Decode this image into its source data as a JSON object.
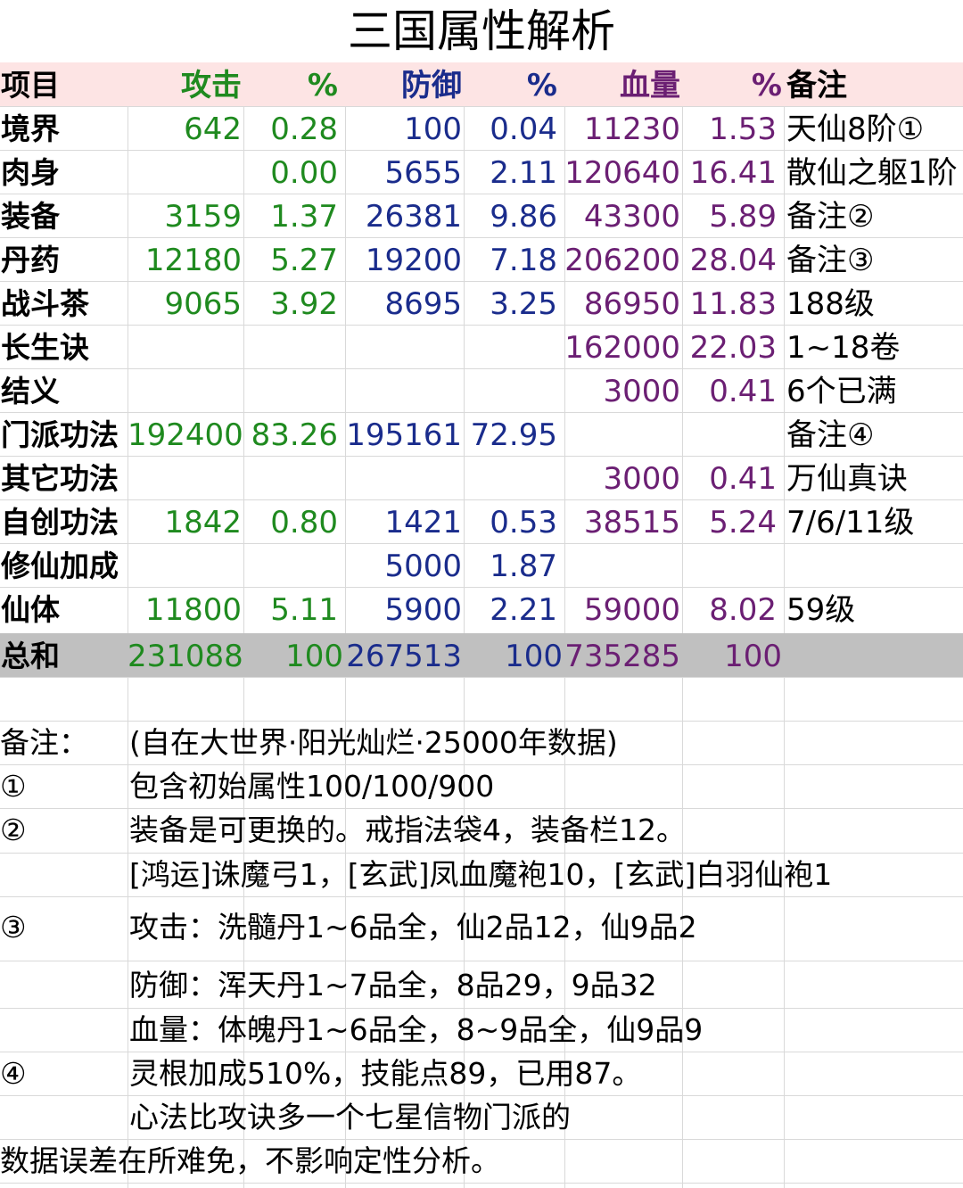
{
  "title": "三国属性解析",
  "header": [
    "项目",
    "攻击",
    "%",
    "防御",
    "%",
    "血量",
    "%",
    "备注"
  ],
  "rows": [
    {
      "cells": [
        "境界",
        "642",
        "0.28",
        "100",
        "0.04",
        "11230",
        "1.53",
        "天仙8阶①"
      ]
    },
    {
      "cells": [
        "肉身",
        "",
        "0.00",
        "5655",
        "2.11",
        "120640",
        "16.41",
        "散仙之躯1阶"
      ]
    },
    {
      "cells": [
        "装备",
        "3159",
        "1.37",
        "26381",
        "9.86",
        "43300",
        "5.89",
        "备注②"
      ]
    },
    {
      "cells": [
        "丹药",
        "12180",
        "5.27",
        "19200",
        "7.18",
        "206200",
        "28.04",
        "备注③"
      ]
    },
    {
      "cells": [
        "战斗茶",
        "9065",
        "3.92",
        "8695",
        "3.25",
        "86950",
        "11.83",
        "188级"
      ]
    },
    {
      "cells": [
        "长生诀",
        "",
        "",
        "",
        "",
        "162000",
        "22.03",
        "1~18卷"
      ]
    },
    {
      "cells": [
        "结义",
        "",
        "",
        "",
        "",
        "3000",
        "0.41",
        "6个已满"
      ]
    },
    {
      "cells": [
        "门派功法",
        "192400",
        "83.26",
        "195161",
        "72.95",
        "",
        "",
        "备注④"
      ]
    },
    {
      "cells": [
        "其它功法",
        "",
        "",
        "",
        "",
        "3000",
        "0.41",
        "万仙真诀"
      ]
    },
    {
      "cells": [
        "自创功法",
        "1842",
        "0.80",
        "1421",
        "0.53",
        "38515",
        "5.24",
        "7/6/11级"
      ]
    },
    {
      "cells": [
        "修仙加成",
        "",
        "",
        "5000",
        "1.87",
        "",
        "",
        ""
      ]
    },
    {
      "cells": [
        "仙体",
        "11800",
        "5.11",
        "5900",
        "2.21",
        "59000",
        "8.02",
        "59级"
      ]
    }
  ],
  "total": {
    "cells": [
      "总和",
      "231088",
      "100",
      "267513",
      "100",
      "735285",
      "100",
      ""
    ]
  },
  "notes": [
    {
      "label": "备注：",
      "text": "(自在大世界·阳光灿烂·25000年数据)"
    },
    {
      "label": "①",
      "text": "包含初始属性100/100/900"
    },
    {
      "label": "②",
      "text": "装备是可更换的。戒指法袋4，装备栏12。"
    },
    {
      "label": "",
      "text": "[鸿运]诛魔弓1，[玄武]凤血魔袍10，[玄武]白羽仙袍1"
    },
    {
      "label": "③",
      "text": "攻击：洗髓丹1~6品全，仙2品12，仙9品2"
    },
    {
      "label": "",
      "text": "防御：浑天丹1~7品全，8品29，9品32"
    },
    {
      "label": "",
      "text": "血量：体魄丹1~6品全，8~9品全，仙9品9"
    },
    {
      "label": "④",
      "text": "灵根加成510%，技能点89，已用87。"
    },
    {
      "label": "",
      "text": "心法比攻诀多一个七星信物门派的"
    },
    {
      "label": "数据误差在所难免，不影响定性分析。",
      "text": ""
    }
  ],
  "colors": {
    "attack": "#1f8a1f",
    "defense": "#1a2c8c",
    "hp": "#6b1f73",
    "header_bg": "#fde4e4",
    "total_bg": "#c0c0c0"
  }
}
